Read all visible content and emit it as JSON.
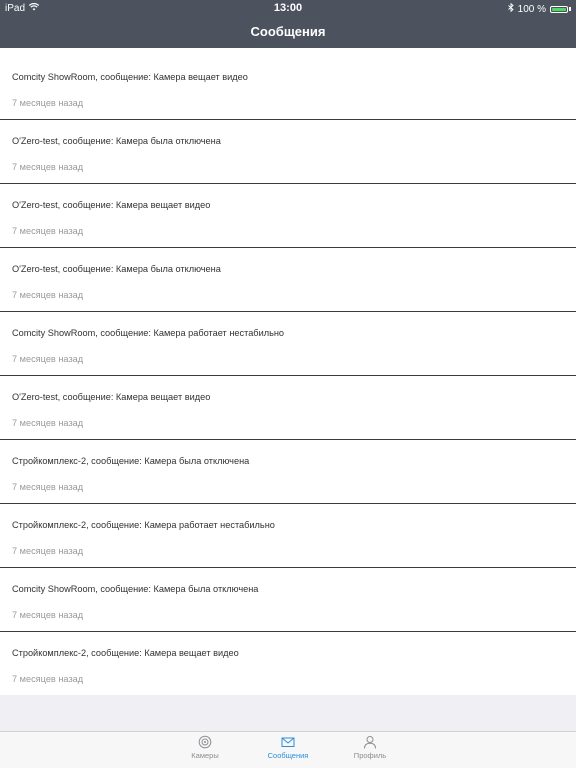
{
  "status_bar": {
    "device": "iPad",
    "time": "13:00",
    "battery": "100 %",
    "battery_level": 1.0
  },
  "nav": {
    "title": "Сообщения"
  },
  "messages": [
    {
      "text": "Comcity ShowRoom, сообщение: Камера вещает видео",
      "time": "7 месяцев назад"
    },
    {
      "text": "O'Zero-test, сообщение: Камера была отключена",
      "time": "7 месяцев назад"
    },
    {
      "text": "O'Zero-test, сообщение: Камера вещает видео",
      "time": "7 месяцев назад"
    },
    {
      "text": "O'Zero-test, сообщение: Камера была отключена",
      "time": "7 месяцев назад"
    },
    {
      "text": "Comcity ShowRoom, сообщение: Камера работает нестабильно",
      "time": "7 месяцев назад"
    },
    {
      "text": "O'Zero-test, сообщение: Камера вещает видео",
      "time": "7 месяцев назад"
    },
    {
      "text": "Стройкомплекс-2, сообщение: Камера была отключена",
      "time": "7 месяцев назад"
    },
    {
      "text": "Стройкомплекс-2, сообщение: Камера работает нестабильно",
      "time": "7 месяцев назад"
    },
    {
      "text": "Comcity ShowRoom, сообщение: Камера была отключена",
      "time": "7 месяцев назад"
    },
    {
      "text": "Стройкомплекс-2, сообщение: Камера вещает видео",
      "time": "7 месяцев назад"
    }
  ],
  "tabs": [
    {
      "label": "Камеры",
      "icon": "camera-icon",
      "active": false
    },
    {
      "label": "Сообщения",
      "icon": "envelope-icon",
      "active": true
    },
    {
      "label": "Профиль",
      "icon": "person-icon",
      "active": false
    }
  ],
  "colors": {
    "bar": "#4c525e",
    "accent": "#2b8fd8",
    "inactive": "#8e8e93",
    "battery": "#4cd964"
  }
}
